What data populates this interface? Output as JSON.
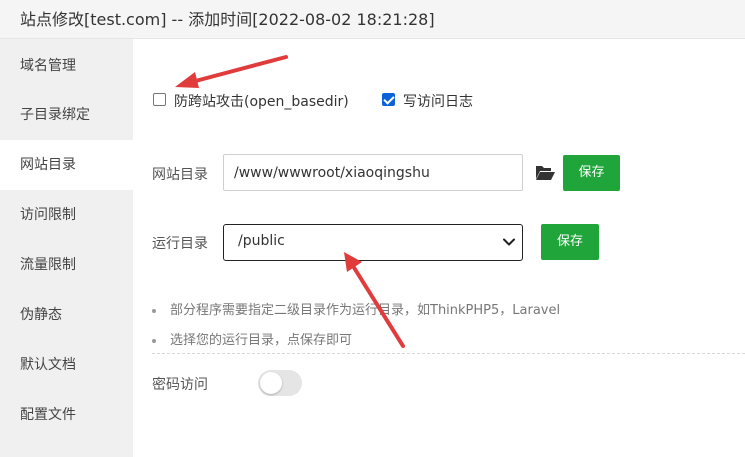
{
  "window": {
    "title": "站点修改[test.com] -- 添加时间[2022-08-02 18:21:28]"
  },
  "sidebar": {
    "items": [
      {
        "label": "域名管理"
      },
      {
        "label": "子目录绑定"
      },
      {
        "label": "网站目录",
        "active": true
      },
      {
        "label": "访问限制"
      },
      {
        "label": "流量限制"
      },
      {
        "label": "伪静态"
      },
      {
        "label": "默认文档"
      },
      {
        "label": "配置文件"
      }
    ]
  },
  "options": {
    "anti_xss": {
      "label": "防跨站攻击(open_basedir)",
      "checked": false
    },
    "access_log": {
      "label": "写访问日志",
      "checked": true
    }
  },
  "site_dir": {
    "label": "网站目录",
    "value": "/www/wwwroot/xiaoqingshu",
    "save_label": "保存",
    "icon": "folder-open-icon"
  },
  "run_dir": {
    "label": "运行目录",
    "selected": "/public",
    "save_label": "保存"
  },
  "tips": [
    "部分程序需要指定二级目录作为运行目录，如ThinkPHP5，Laravel",
    "选择您的运行目录，点保存即可"
  ],
  "password_access": {
    "label": "密码访问",
    "enabled": false
  },
  "colors": {
    "accent": "#20a53a",
    "annotation_arrow": "#e03c3c",
    "checkbox": "#0b63d7"
  }
}
